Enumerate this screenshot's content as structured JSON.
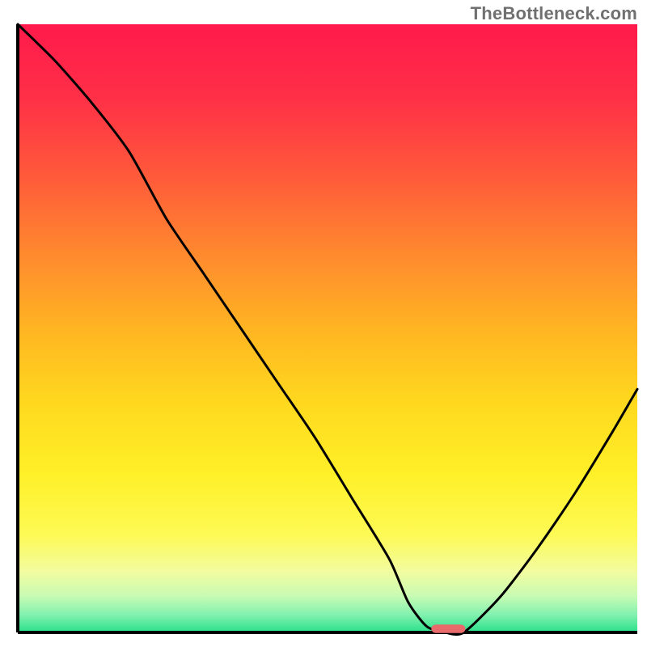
{
  "watermark": "TheBottleneck.com",
  "chart_data": {
    "type": "line",
    "title": "",
    "xlabel": "",
    "ylabel": "",
    "xlim": [
      0,
      100
    ],
    "ylim": [
      0,
      100
    ],
    "background_gradient": {
      "stops": [
        {
          "pos": 0.0,
          "color": "#ff1a4b"
        },
        {
          "pos": 0.12,
          "color": "#ff2f47"
        },
        {
          "pos": 0.25,
          "color": "#ff5a3a"
        },
        {
          "pos": 0.38,
          "color": "#ff8a2e"
        },
        {
          "pos": 0.5,
          "color": "#ffb422"
        },
        {
          "pos": 0.62,
          "color": "#ffd81e"
        },
        {
          "pos": 0.74,
          "color": "#fff028"
        },
        {
          "pos": 0.84,
          "color": "#fdfa55"
        },
        {
          "pos": 0.9,
          "color": "#f2fca0"
        },
        {
          "pos": 0.94,
          "color": "#c8fbb3"
        },
        {
          "pos": 0.97,
          "color": "#84f2b0"
        },
        {
          "pos": 1.0,
          "color": "#29e08a"
        }
      ]
    },
    "series": [
      {
        "name": "bottleneck-curve",
        "color": "#000000",
        "width": 3,
        "x": [
          0,
          6,
          12,
          18,
          24,
          30,
          36,
          42,
          48,
          54,
          60,
          63,
          66,
          69,
          72,
          78,
          84,
          90,
          96,
          100
        ],
        "y": [
          100,
          94,
          87,
          79,
          68,
          59,
          50,
          41,
          32,
          22,
          12,
          5,
          1,
          0,
          0,
          6,
          14,
          23,
          33,
          40
        ]
      }
    ],
    "marker": {
      "name": "optimal-zone",
      "x": 69.5,
      "y": 0.6,
      "width": 5.5,
      "height": 1.4,
      "color": "#e96a6a",
      "radius": 6
    },
    "axes": {
      "left": {
        "x": 2,
        "y1": 2,
        "y2": 98
      },
      "bottom": {
        "y": 98,
        "x1": 2,
        "x2": 98
      }
    }
  }
}
